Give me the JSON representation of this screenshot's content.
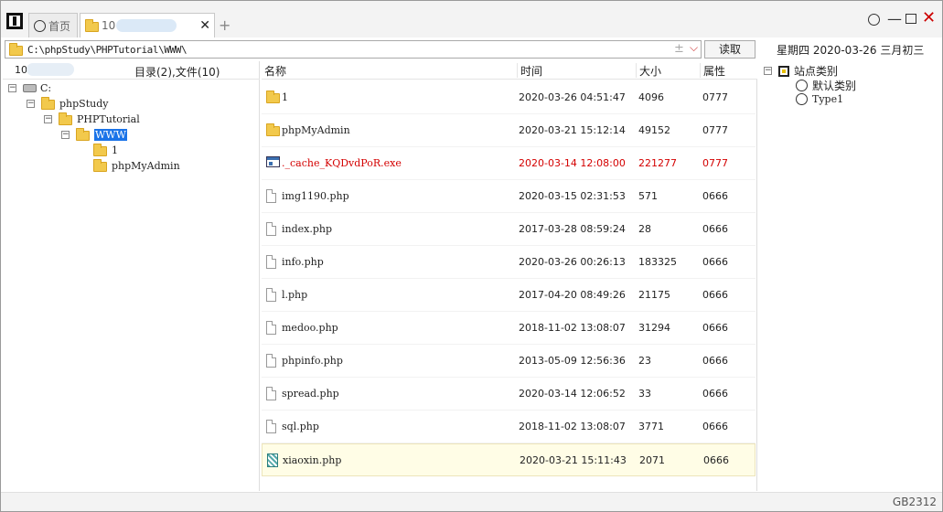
{
  "tabs": {
    "home_label": "首页",
    "active_label": "10",
    "add_symbol": "+",
    "close_symbol": "✕"
  },
  "window_controls": {
    "minimize_symbol": "—",
    "close_symbol": "✕"
  },
  "address": {
    "path": "C:\\phpStudy\\PHPTutorial\\WWW\\",
    "plus_symbol": "±",
    "dropdown_symbol": "⌵",
    "read_button": "读取"
  },
  "date_text": "星期四  2020-03-26  三月初三",
  "left_pane": {
    "count_prefix": "10",
    "summary": "目录(2),文件(10)",
    "tree": [
      {
        "label": "C:",
        "expander": "−"
      },
      {
        "label": "phpStudy",
        "expander": "−"
      },
      {
        "label": "PHPTutorial",
        "expander": "−"
      },
      {
        "label": "WWW",
        "expander": "−"
      },
      {
        "label": "1"
      },
      {
        "label": "phpMyAdmin"
      }
    ]
  },
  "file_list": {
    "headers": {
      "name": "名称",
      "time": "时间",
      "size": "大小",
      "perm": "属性"
    },
    "rows": [
      {
        "name": "1",
        "time": "2020-03-26 04:51:47",
        "size": "4096",
        "perm": "0777",
        "icon": "folder-icon"
      },
      {
        "name": "phpMyAdmin",
        "time": "2020-03-21 15:12:14",
        "size": "49152",
        "perm": "0777",
        "icon": "folder-icon"
      },
      {
        "name": "._cache_KQDvdPoR.exe",
        "time": "2020-03-14 12:08:00",
        "size": "221277",
        "perm": "0777",
        "icon": "exe-icon",
        "highlight_color": "#d40000"
      },
      {
        "name": "img1190.php",
        "time": "2020-03-15 02:31:53",
        "size": "571",
        "perm": "0666",
        "icon": "document-icon"
      },
      {
        "name": "index.php",
        "time": "2017-03-28 08:59:24",
        "size": "28",
        "perm": "0666",
        "icon": "document-icon"
      },
      {
        "name": "info.php",
        "time": "2020-03-26 00:26:13",
        "size": "183325",
        "perm": "0666",
        "icon": "document-icon"
      },
      {
        "name": "l.php",
        "time": "2017-04-20 08:49:26",
        "size": "21175",
        "perm": "0666",
        "icon": "document-icon"
      },
      {
        "name": "medoo.php",
        "time": "2018-11-02 13:08:07",
        "size": "31294",
        "perm": "0666",
        "icon": "document-icon"
      },
      {
        "name": "phpinfo.php",
        "time": "2013-05-09 12:56:36",
        "size": "23",
        "perm": "0666",
        "icon": "document-icon"
      },
      {
        "name": "spread.php",
        "time": "2020-03-14 12:06:52",
        "size": "33",
        "perm": "0666",
        "icon": "document-icon"
      },
      {
        "name": "sql.php",
        "time": "2018-11-02 13:08:07",
        "size": "3771",
        "perm": "0666",
        "icon": "document-icon"
      },
      {
        "name": "xiaoxin.php",
        "time": "2020-03-21 15:11:43",
        "size": "2071",
        "perm": "0666",
        "icon": "hatched-file-icon"
      }
    ]
  },
  "categories": {
    "root_label": "站点类别",
    "root_expander": "−",
    "items": [
      "默认类别",
      "Type1"
    ]
  },
  "status": {
    "encoding": "GB2312"
  }
}
